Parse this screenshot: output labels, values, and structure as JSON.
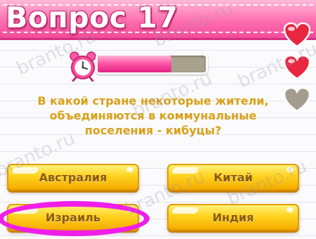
{
  "header": {
    "title": "Вопрос 17"
  },
  "timer": {
    "remaining_fraction": 0.68
  },
  "lives": {
    "total": 3,
    "remaining": 2
  },
  "question": {
    "lines": [
      "В какой стране некоторые жители,",
      "объединяются в коммунальные",
      "поселения - кибуцы?"
    ]
  },
  "answers": [
    {
      "label": "Австралия"
    },
    {
      "label": "Китай"
    },
    {
      "label": "Израиль",
      "highlighted": true
    },
    {
      "label": "Индия"
    }
  ],
  "watermark": {
    "text": "branto.ru"
  },
  "colors": {
    "header_pink": "#ff6fb0",
    "timer_pink": "#ff5aa8",
    "question_text": "#d9a11a",
    "button_yellow": "#ffd21f",
    "marker_magenta": "#f01ee8",
    "heart_red": "#e8263f",
    "heart_empty": "#a49c8e"
  }
}
